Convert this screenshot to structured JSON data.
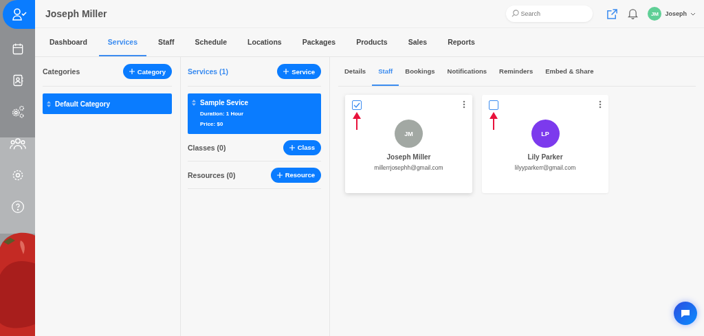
{
  "sidebar": {
    "items": [
      {
        "kind": "user-check",
        "selected": true
      },
      {
        "kind": "calendar",
        "selected": false
      },
      {
        "kind": "contacts",
        "selected": false
      },
      {
        "kind": "gears",
        "selected": false
      },
      {
        "kind": "people",
        "selected": false
      },
      {
        "kind": "settings",
        "selected": false
      },
      {
        "kind": "help",
        "selected": false
      }
    ]
  },
  "header": {
    "title": "Joseph Miller",
    "search": {
      "placeholder": "Search"
    },
    "user": {
      "initials": "JM",
      "name": "Joseph"
    }
  },
  "tabs": [
    {
      "label": "Dashboard",
      "selected": false
    },
    {
      "label": "Services",
      "selected": true
    },
    {
      "label": "Staff",
      "selected": false
    },
    {
      "label": "Schedule",
      "selected": false
    },
    {
      "label": "Locations",
      "selected": false
    },
    {
      "label": "Packages",
      "selected": false
    },
    {
      "label": "Products",
      "selected": false
    },
    {
      "label": "Sales",
      "selected": false
    },
    {
      "label": "Reports",
      "selected": false
    }
  ],
  "categories": {
    "title": "Categories",
    "button": "Category",
    "items": [
      {
        "name": "Default Category",
        "selected": true
      }
    ]
  },
  "services": {
    "title": "Services (1)",
    "button": "Service",
    "items": [
      {
        "name": "Sample Sevice",
        "duration": "Duration: 1 Hour",
        "price": "Price: $0",
        "selected": true
      }
    ],
    "sections": [
      {
        "title": "Classes",
        "count": "(0)",
        "button": "Class"
      },
      {
        "title": "Resources",
        "count": "(0)",
        "button": "Resource"
      }
    ]
  },
  "detail_tabs": [
    {
      "label": "Details",
      "selected": false
    },
    {
      "label": "Staff",
      "selected": true
    },
    {
      "label": "Bookings",
      "selected": false
    },
    {
      "label": "Notifications",
      "selected": false
    },
    {
      "label": "Reminders",
      "selected": false
    },
    {
      "label": "Embed & Share",
      "selected": false
    }
  ],
  "staff": [
    {
      "initials": "JM",
      "color": "#a2a8a3",
      "name": "Joseph Miller",
      "email": "millerrjosephh@gmail.com",
      "checked": true,
      "pointer_arrow": true
    },
    {
      "initials": "LP",
      "color": "#7c3aed",
      "name": "Lily Parker",
      "email": "lilyyparkerr@gmail.com",
      "checked": false,
      "pointer_arrow": true
    }
  ]
}
